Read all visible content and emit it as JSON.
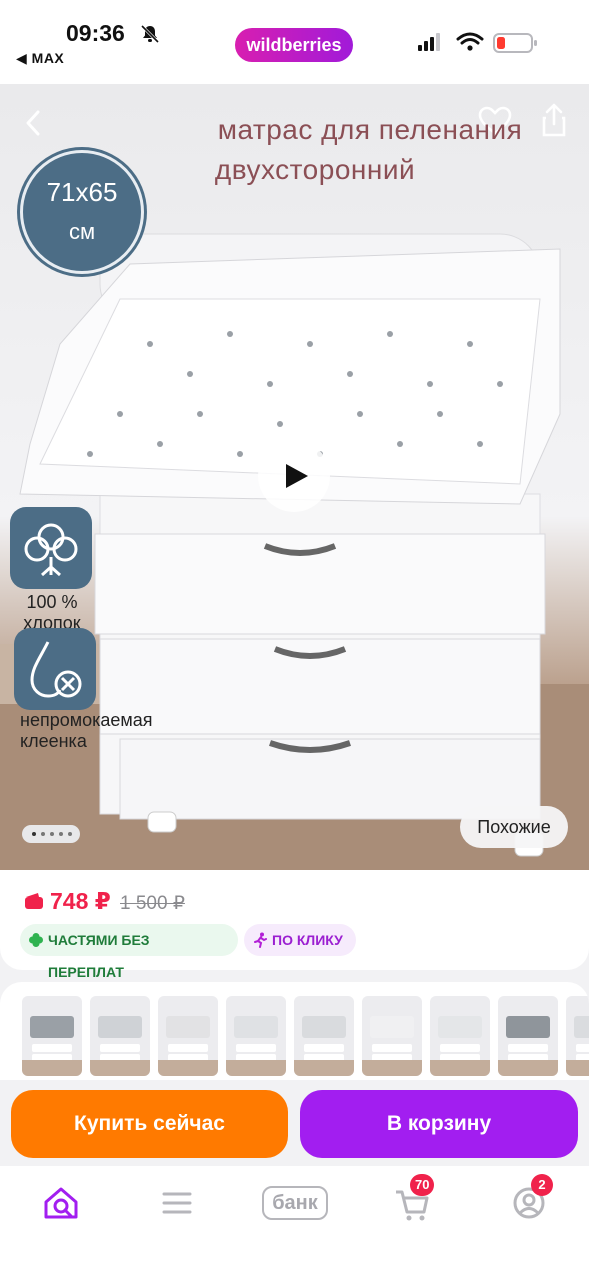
{
  "status_bar": {
    "time": "09:36",
    "back_app": "◀ MAX",
    "brand": "wildberries"
  },
  "product_image": {
    "title_line1": "матрас для пеленания",
    "title_line2": "двухсторонний",
    "size_line1": "71x65",
    "size_line2": "см",
    "feature_1_line1": "100 %",
    "feature_1_line2": "хлопок",
    "feature_2_line1": "непромокаемая",
    "feature_2_line2": "клеенка",
    "similar_label": "Похожие",
    "gallery_dots": 5,
    "active_dot": 1
  },
  "price": {
    "current": "748 ₽",
    "old": "1 500 ₽",
    "chip_installments": "ЧАСТЯМИ БЕЗ ПЕРЕПЛАТ",
    "chip_one_click": "ПО КЛИКУ"
  },
  "thumbnails_count": 9,
  "actions": {
    "buy_now": "Купить сейчас",
    "add_to_cart": "В корзину"
  },
  "tabbar": {
    "home_icon": "home-search-icon",
    "catalog_icon": "menu-icon",
    "bank_label": "банк",
    "cart_badge": "70",
    "profile_badge": "2"
  },
  "colors": {
    "brand_gradient_start": "#d81fb0",
    "brand_gradient_end": "#a11ad9",
    "price": "#f0224b",
    "buy_now": "#ff7a00",
    "add_to_cart": "#a21ef0",
    "badge": "#4c6d86"
  }
}
